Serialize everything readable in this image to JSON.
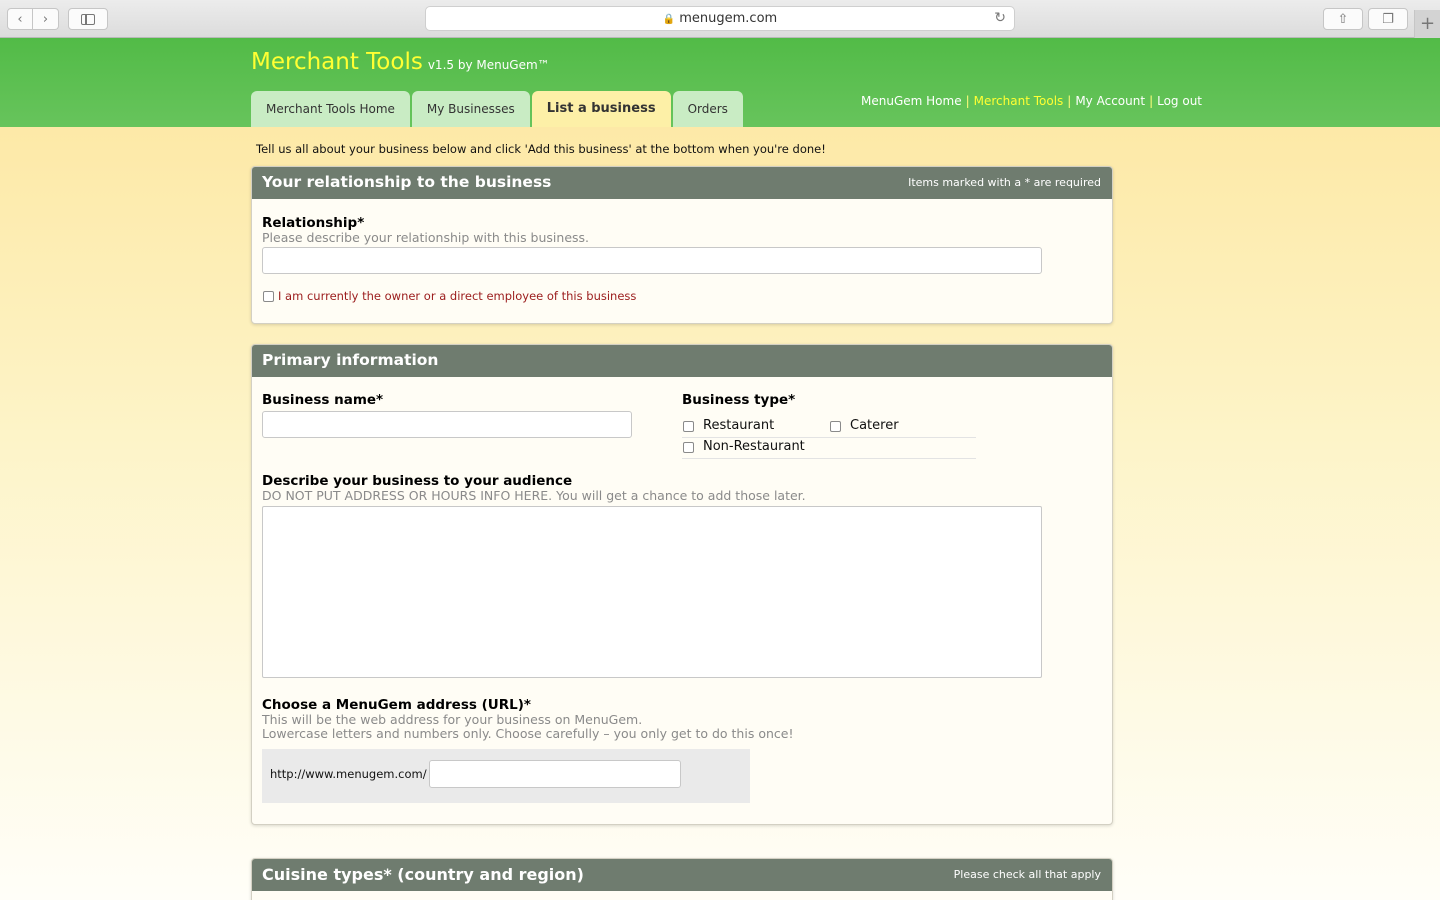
{
  "browser": {
    "url": "menugem.com"
  },
  "header": {
    "brand": "Merchant Tools",
    "version": "v1.5 by MenuGem™",
    "tabs": [
      {
        "label": "Merchant Tools Home",
        "active": false
      },
      {
        "label": "My Businesses",
        "active": false
      },
      {
        "label": "List a business",
        "active": true
      },
      {
        "label": "Orders",
        "active": false
      }
    ],
    "links": [
      {
        "label": "MenuGem Home",
        "current": false
      },
      {
        "label": "Merchant Tools",
        "current": true
      },
      {
        "label": "My Account",
        "current": false
      },
      {
        "label": "Log out",
        "current": false
      }
    ]
  },
  "intro": "Tell us all about your business below and click 'Add this business' at the bottom when you're done!",
  "relationship_section": {
    "title": "Your relationship to the business",
    "note": "Items marked with a * are required",
    "field_label": "Relationship*",
    "field_hint": "Please describe your relationship with this business.",
    "field_value": "",
    "owner_checkbox_label": "I am currently the owner or a direct employee of this business",
    "owner_checked": false
  },
  "primary_section": {
    "title": "Primary information",
    "business_name_label": "Business name*",
    "business_name_value": "",
    "business_type_label": "Business type*",
    "business_types": [
      {
        "label": "Restaurant",
        "checked": false
      },
      {
        "label": "Caterer",
        "checked": false
      },
      {
        "label": "Non-Restaurant",
        "checked": false
      }
    ],
    "describe_label": "Describe your business to your audience",
    "describe_hint": "DO NOT PUT ADDRESS OR HOURS INFO HERE. You will get a chance to add those later.",
    "describe_value": "",
    "url_label": "Choose a MenuGem address (URL)*",
    "url_hint_1": "This will be the web address for your business on MenuGem.",
    "url_hint_2": "Lowercase letters and numbers only. Choose carefully – you only get to do this once!",
    "url_prefix": "http://www.menugem.com/",
    "url_value": ""
  },
  "cuisine_section": {
    "title": "Cuisine types* (country and region)",
    "note": "Please check all that apply"
  },
  "colors": {
    "header_green": "#52bb47",
    "brand_yellow": "#ffff33",
    "panel_head": "#6f7c6f",
    "owner_text": "#9b1c1c"
  }
}
